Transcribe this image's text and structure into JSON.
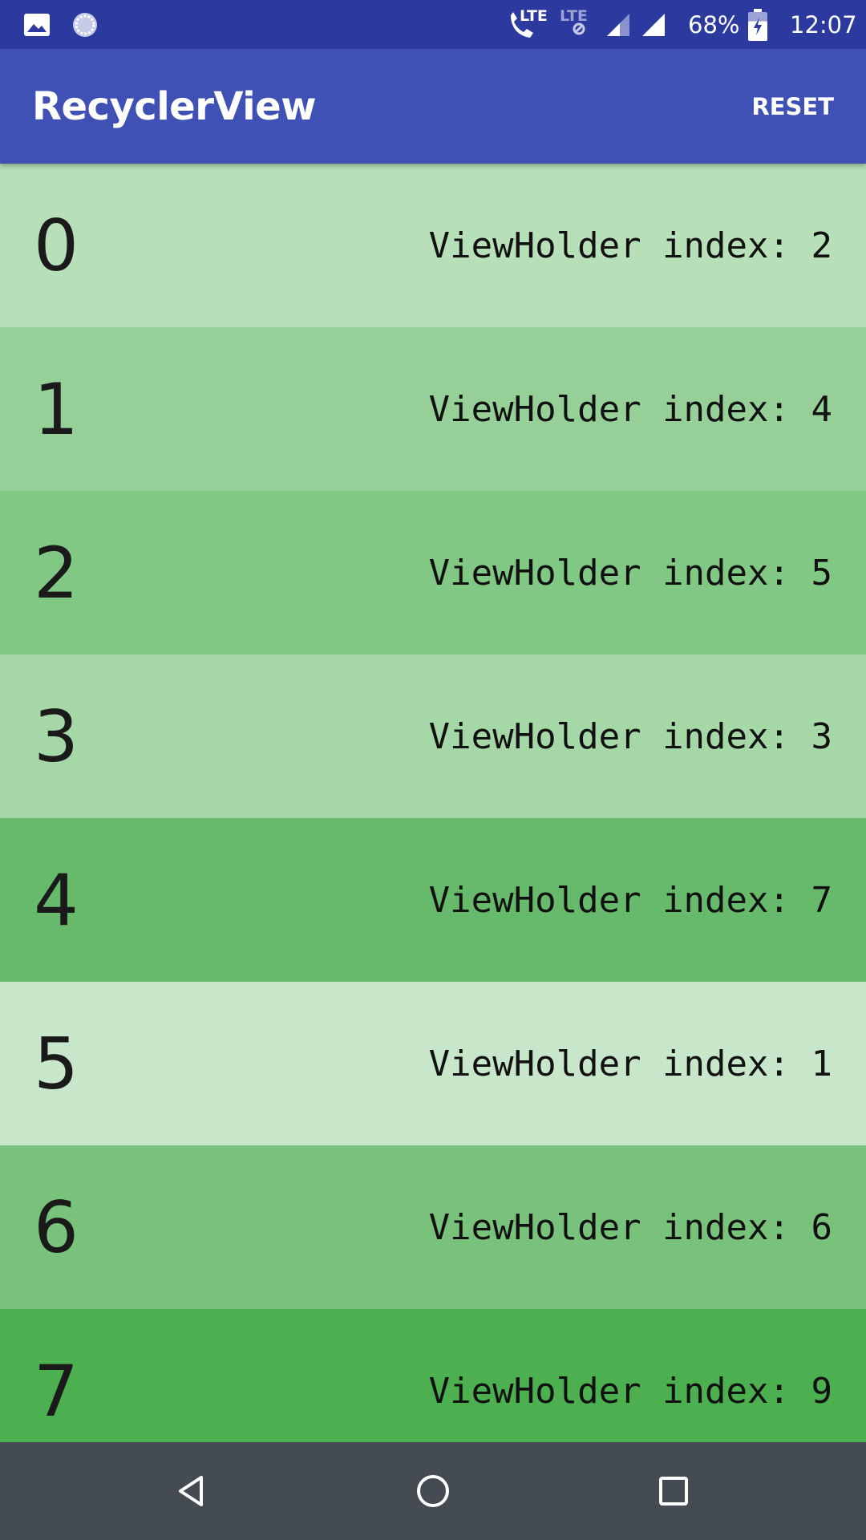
{
  "status_bar": {
    "call_badge": "LTE",
    "data_badge": "LTE",
    "battery_percent": "68%",
    "time": "12:07",
    "battery_level": 0.68,
    "icons": [
      "image-icon",
      "sync-icon",
      "volte-call-icon",
      "lte-data-icon",
      "signal-icon",
      "signal-icon",
      "battery-charging-icon"
    ]
  },
  "app_bar": {
    "title": "RecyclerView",
    "reset_label": "RESET"
  },
  "list": {
    "rows": [
      {
        "number": "0",
        "holder_text": "ViewHolder index: 2",
        "color": "#b7dfb8"
      },
      {
        "number": "1",
        "holder_text": "ViewHolder index: 4",
        "color": "#96d098"
      },
      {
        "number": "2",
        "holder_text": "ViewHolder index: 5",
        "color": "#81c884"
      },
      {
        "number": "3",
        "holder_text": "ViewHolder index: 3",
        "color": "#a5d7a7"
      },
      {
        "number": "4",
        "holder_text": "ViewHolder index: 7",
        "color": "#67ba6b"
      },
      {
        "number": "5",
        "holder_text": "ViewHolder index: 1",
        "color": "#c8e6c9"
      },
      {
        "number": "6",
        "holder_text": "ViewHolder index: 6",
        "color": "#79c27c"
      },
      {
        "number": "7",
        "holder_text": "ViewHolder index: 9",
        "color": "#4caf50"
      }
    ]
  },
  "nav_bar": {
    "icons": [
      "back-icon",
      "home-icon",
      "recents-icon"
    ]
  },
  "colors": {
    "status_bar": "#2c3a9f",
    "app_bar": "#3f51b5",
    "nav_bar": "#444b52"
  }
}
